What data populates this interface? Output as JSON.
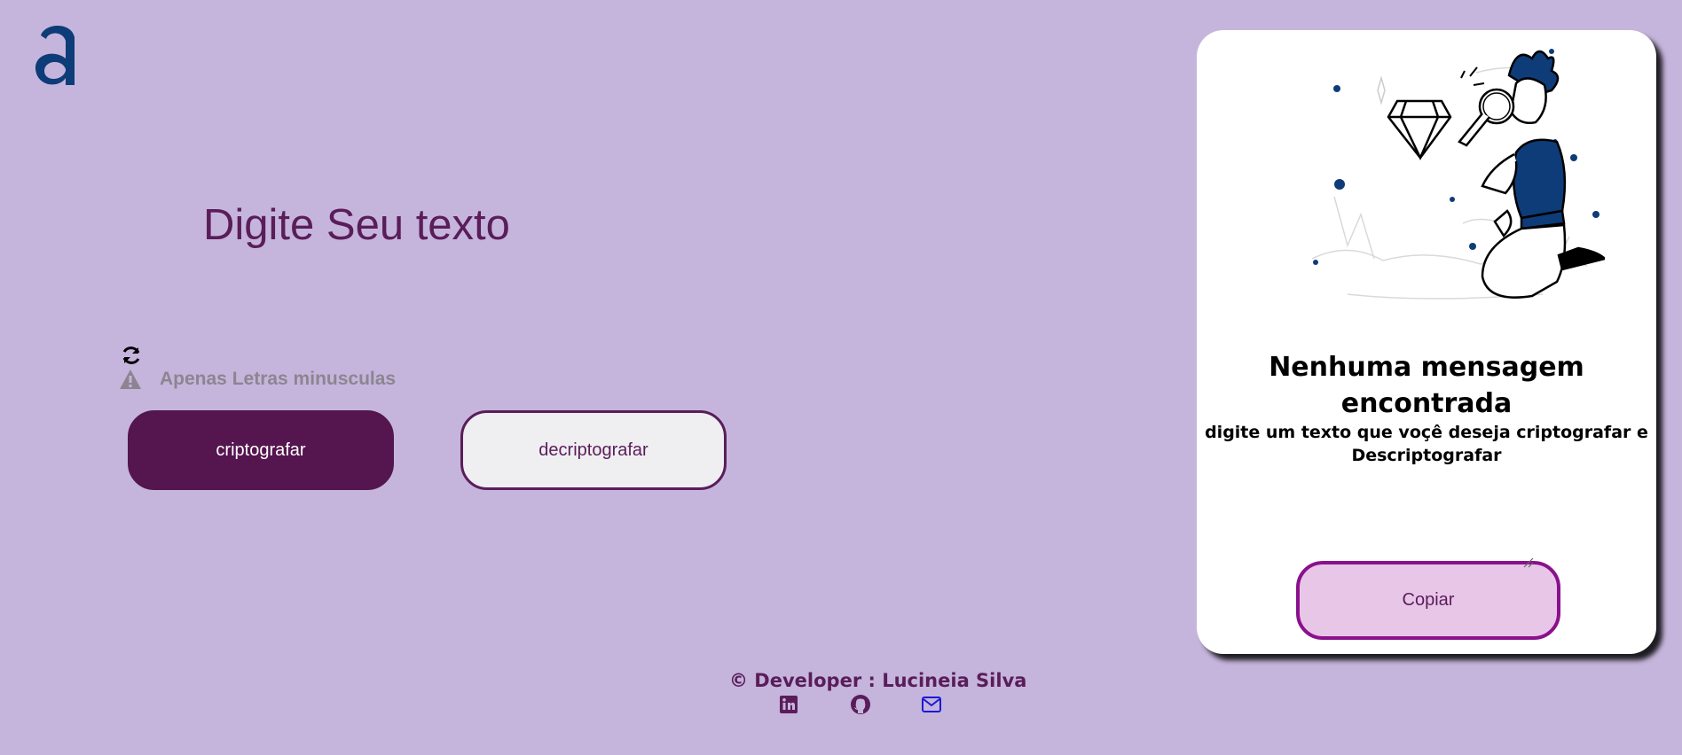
{
  "logo": {
    "icon": "logo-a-icon",
    "color": "#0e3c78"
  },
  "input": {
    "placeholder": "Digite Seu texto"
  },
  "warning": {
    "icon": "warning-icon",
    "text": "Apenas Letras minusculas"
  },
  "refresh": {
    "icon": "refresh-icon"
  },
  "buttons": {
    "encrypt": "criptografar",
    "decrypt": "decriptografar"
  },
  "output_card": {
    "illustration": "detective-with-magnifier-illustration",
    "title": "Nenhuma mensagem encontrada",
    "description": "digite um texto que voçê deseja criptografar e Descriptografar",
    "copy_label": "Copiar"
  },
  "footer": {
    "credit": "© Developer : Lucineia Silva",
    "links": [
      "linkedin-icon",
      "github-icon",
      "mail-icon"
    ]
  },
  "colors": {
    "background": "#c5b5dc",
    "accent": "#55154f",
    "text": "#5a1d5a",
    "copy_border": "#8a118c"
  }
}
